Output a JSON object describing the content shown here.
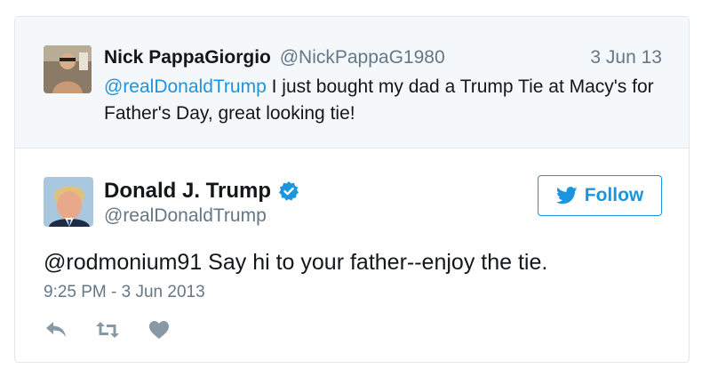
{
  "colors": {
    "link": "#1b95e0",
    "secondary_text": "#657786",
    "primary_text": "#14171a",
    "parent_background": "#f5f8fa",
    "border": "#e1e8ed"
  },
  "parent_tweet": {
    "avatar_icon": "user-avatar",
    "name": "Nick PappaGiorgio",
    "handle": "@NickPappaG1980",
    "date": "3 Jun 13",
    "mention": "@realDonaldTrump",
    "text": " I just bought my dad a Trump Tie at Macy's for Father's Day, great looking tie!"
  },
  "tweet": {
    "avatar_icon": "user-avatar",
    "name": "Donald J. Trump",
    "verified_icon": "verified-badge-icon",
    "handle": "@realDonaldTrump",
    "follow_label": "Follow",
    "text": "@rodmonium91 Say hi to your father--enjoy the tie.",
    "timestamp": "9:25 PM - 3 Jun 2013",
    "actions": [
      "reply-icon",
      "retweet-icon",
      "like-icon"
    ]
  }
}
